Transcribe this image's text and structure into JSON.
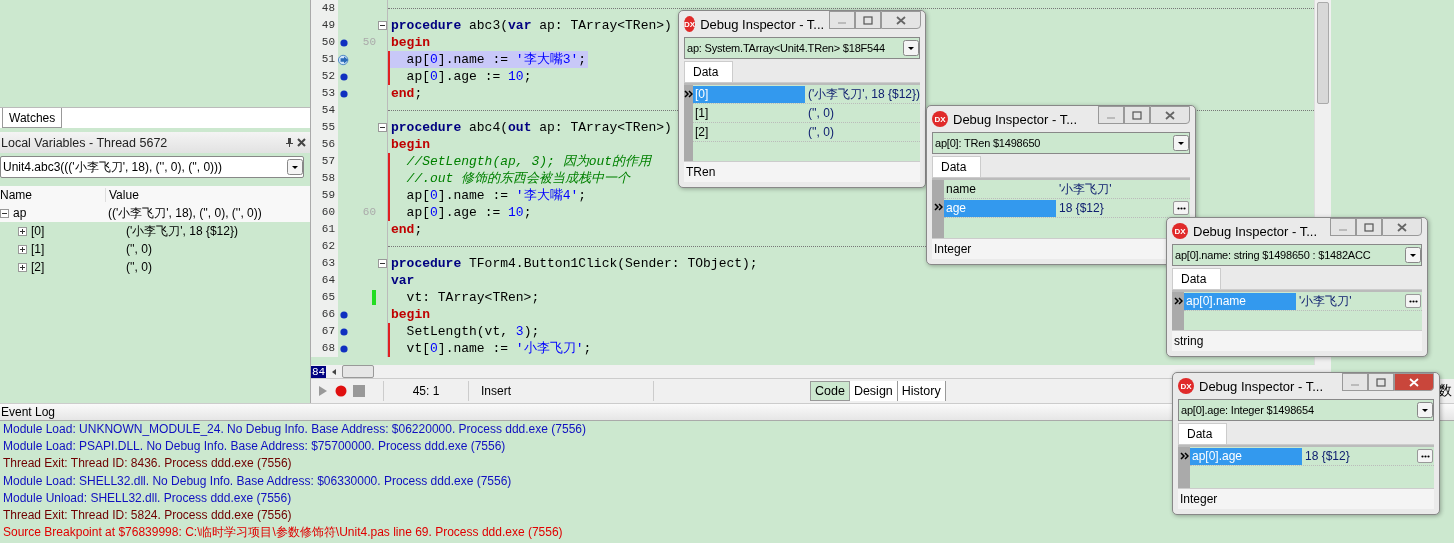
{
  "locals_panel": {
    "tab": "Watches",
    "title": "Local Variables - Thread 5672",
    "frame": "Unit4.abc3((('小李飞刀', 18), ('', 0), ('', 0)))",
    "columns": [
      "Name",
      "Value"
    ],
    "rows": [
      {
        "name": "ap",
        "value": "(('小李飞刀', 18), ('', 0), ('', 0))",
        "expanded": true,
        "children": [
          {
            "name": "[0]",
            "value": "('小李飞刀', 18 {$12})",
            "expanded": false
          },
          {
            "name": "[1]",
            "value": "('', 0)",
            "expanded": false
          },
          {
            "name": "[2]",
            "value": "('', 0)",
            "expanded": false
          }
        ]
      }
    ]
  },
  "editor": {
    "lines": [
      {
        "number": "48",
        "kind": "separator"
      },
      {
        "number": "49",
        "kind": "code",
        "fold": true,
        "tokens": [
          {
            "kind": "keyword",
            "text": "procedure"
          },
          {
            "kind": "plain",
            "text": " abc3("
          },
          {
            "kind": "keyword",
            "text": "var"
          },
          {
            "kind": "plain",
            "text": " ap: TArray<TRen>)"
          }
        ]
      },
      {
        "number": "50",
        "kind": "code",
        "breakpoint": true,
        "label": "50",
        "tokens": [
          {
            "kind": "block",
            "text": "begin"
          }
        ]
      },
      {
        "number": "51",
        "kind": "code",
        "current": true,
        "highlighted": true,
        "block_bar": true,
        "tokens": [
          {
            "kind": "plain",
            "text": "  ap["
          },
          {
            "kind": "number",
            "text": "0"
          },
          {
            "kind": "plain",
            "text": "].name := "
          },
          {
            "kind": "string",
            "text": "'李大嘴3'"
          },
          {
            "kind": "plain",
            "text": ";"
          }
        ]
      },
      {
        "number": "52",
        "kind": "code",
        "breakpoint": true,
        "block_bar": true,
        "tokens": [
          {
            "kind": "plain",
            "text": "  ap["
          },
          {
            "kind": "number",
            "text": "0"
          },
          {
            "kind": "plain",
            "text": "].age := "
          },
          {
            "kind": "number",
            "text": "10"
          },
          {
            "kind": "plain",
            "text": ";"
          }
        ]
      },
      {
        "number": "53",
        "kind": "code",
        "breakpoint": true,
        "tokens": [
          {
            "kind": "block",
            "text": "end"
          },
          {
            "kind": "plain",
            "text": ";"
          }
        ]
      },
      {
        "number": "54",
        "kind": "separator"
      },
      {
        "number": "55",
        "kind": "code",
        "fold": true,
        "tokens": [
          {
            "kind": "keyword",
            "text": "procedure"
          },
          {
            "kind": "plain",
            "text": " abc4("
          },
          {
            "kind": "keyword",
            "text": "out"
          },
          {
            "kind": "plain",
            "text": " ap: TArray<TRen>)"
          }
        ]
      },
      {
        "number": "56",
        "kind": "code",
        "tokens": [
          {
            "kind": "block",
            "text": "begin"
          }
        ]
      },
      {
        "number": "57",
        "kind": "code",
        "block_bar": true,
        "tokens": [
          {
            "kind": "comment",
            "text": "  //SetLength(ap, 3); 因为out的作用"
          }
        ]
      },
      {
        "number": "58",
        "kind": "code",
        "block_bar": true,
        "tokens": [
          {
            "kind": "comment",
            "text": "  //.out 修饰的东西会被当成栈中一个"
          }
        ]
      },
      {
        "number": "59",
        "kind": "code",
        "block_bar": true,
        "tokens": [
          {
            "kind": "plain",
            "text": "  ap["
          },
          {
            "kind": "number",
            "text": "0"
          },
          {
            "kind": "plain",
            "text": "].name := "
          },
          {
            "kind": "string",
            "text": "'李大嘴4'"
          },
          {
            "kind": "plain",
            "text": ";"
          }
        ]
      },
      {
        "number": "60",
        "kind": "code",
        "label": "60",
        "block_bar": true,
        "tokens": [
          {
            "kind": "plain",
            "text": "  ap["
          },
          {
            "kind": "number",
            "text": "0"
          },
          {
            "kind": "plain",
            "text": "].age := "
          },
          {
            "kind": "number",
            "text": "10"
          },
          {
            "kind": "plain",
            "text": ";"
          }
        ]
      },
      {
        "number": "61",
        "kind": "code",
        "tokens": [
          {
            "kind": "block",
            "text": "end"
          },
          {
            "kind": "plain",
            "text": ";"
          }
        ]
      },
      {
        "number": "62",
        "kind": "separator"
      },
      {
        "number": "63",
        "kind": "code",
        "fold": true,
        "tokens": [
          {
            "kind": "keyword",
            "text": "procedure"
          },
          {
            "kind": "plain",
            "text": " TForm4.Button1Click(Sender: TObject);"
          }
        ]
      },
      {
        "number": "64",
        "kind": "code",
        "tokens": [
          {
            "kind": "keyword",
            "text": "var"
          }
        ]
      },
      {
        "number": "65",
        "kind": "code",
        "changed": true,
        "tokens": [
          {
            "kind": "plain",
            "text": "  vt: TArray<TRen>;"
          }
        ]
      },
      {
        "number": "66",
        "kind": "code",
        "breakpoint": true,
        "tokens": [
          {
            "kind": "block",
            "text": "begin"
          }
        ]
      },
      {
        "number": "67",
        "kind": "code",
        "breakpoint": true,
        "block_bar": true,
        "tokens": [
          {
            "kind": "plain",
            "text": "  SetLength(vt, "
          },
          {
            "kind": "number",
            "text": "3"
          },
          {
            "kind": "plain",
            "text": ");"
          }
        ]
      },
      {
        "number": "68",
        "kind": "code",
        "breakpoint": true,
        "block_bar": true,
        "tokens": [
          {
            "kind": "plain",
            "text": "  vt["
          },
          {
            "kind": "number",
            "text": "0"
          },
          {
            "kind": "plain",
            "text": "].name := "
          },
          {
            "kind": "string",
            "text": "'小李飞刀'"
          },
          {
            "kind": "plain",
            "text": ";"
          }
        ]
      }
    ],
    "line_badge": "84",
    "status": {
      "position": "45: 1",
      "mode": "Insert"
    },
    "view_tabs": [
      {
        "label": "Code",
        "selected": true
      },
      {
        "label": "Design",
        "selected": false
      },
      {
        "label": "History",
        "selected": false
      }
    ],
    "background_fragment": "数"
  },
  "event_log": {
    "title": "Event Log",
    "entries": [
      {
        "kind": "module",
        "text": "Module Load: UNKNOWN_MODULE_24. No Debug Info. Base Address: $06220000. Process ddd.exe (7556)"
      },
      {
        "kind": "module",
        "text": "Module Load: PSAPI.DLL. No Debug Info. Base Address: $75700000. Process ddd.exe (7556)"
      },
      {
        "kind": "thread",
        "text": "Thread Exit: Thread ID: 8436. Process ddd.exe (7556)"
      },
      {
        "kind": "module",
        "text": "Module Load: SHELL32.dll. No Debug Info. Base Address: $06330000. Process ddd.exe (7556)"
      },
      {
        "kind": "module",
        "text": "Module Unload: SHELL32.dll. Process ddd.exe (7556)"
      },
      {
        "kind": "thread",
        "text": "Thread Exit: Thread ID: 5824. Process ddd.exe (7556)"
      },
      {
        "kind": "breakpoint",
        "text": "Source Breakpoint at $76839998: C:\\临时学习项目\\参数修饰符\\Unit4.pas line 69. Process ddd.exe (7556)"
      }
    ]
  },
  "inspectors": [
    {
      "icon_label": "DX",
      "title": "Debug Inspector - T...",
      "active": false,
      "expression": "ap: System.TArray<Unit4.TRen> $18F544",
      "tab": "Data",
      "rows": [
        {
          "name": "[0]",
          "value": "('小李飞刀', 18 {$12})",
          "selected": true
        },
        {
          "name": "[1]",
          "value": "('', 0)",
          "selected": false
        },
        {
          "name": "[2]",
          "value": "('', 0)",
          "selected": false
        }
      ],
      "edit_button": false,
      "type": "TRen"
    },
    {
      "icon_label": "DX",
      "title": "Debug Inspector - T...",
      "active": false,
      "expression": "ap[0]: TRen $1498650",
      "tab": "Data",
      "rows": [
        {
          "name": "name",
          "value": "'小李飞刀'",
          "selected": false
        },
        {
          "name": "age",
          "value": "18 {$12}",
          "selected": true
        }
      ],
      "edit_button": true,
      "type": "Integer"
    },
    {
      "icon_label": "DX",
      "title": "Debug Inspector - T...",
      "active": false,
      "expression": "ap[0].name: string $1498650 : $1482ACC",
      "tab": "Data",
      "rows": [
        {
          "name": "ap[0].name",
          "value": "'小李飞刀'",
          "selected": true
        }
      ],
      "edit_button": true,
      "type": "string"
    },
    {
      "icon_label": "DX",
      "title": "Debug Inspector - T...",
      "active": true,
      "expression": "ap[0].age: Integer $1498654",
      "tab": "Data",
      "rows": [
        {
          "name": "ap[0].age",
          "value": "18 {$12}",
          "selected": true
        }
      ],
      "edit_button": true,
      "type": "Integer"
    }
  ]
}
